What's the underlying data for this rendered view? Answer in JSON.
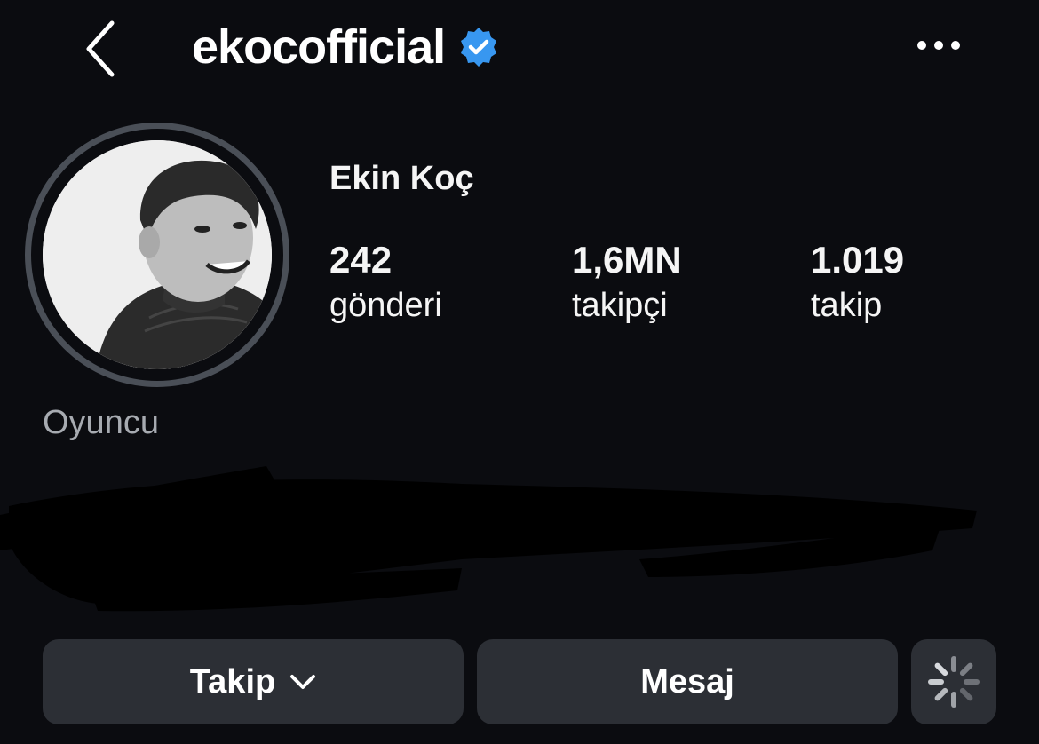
{
  "header": {
    "username": "ekocofficial",
    "verified_icon": "verified-badge-icon",
    "accent_color": "#3897f0"
  },
  "profile": {
    "full_name": "Ekin Koç",
    "category": "Oyuncu",
    "stats": [
      {
        "value": "242",
        "label": "gönderi"
      },
      {
        "value": "1,6MN",
        "label": "takipçi"
      },
      {
        "value": "1.019",
        "label": "takip"
      }
    ]
  },
  "actions": {
    "follow_label": "Takip",
    "message_label": "Mesaj",
    "more_icon": "loading-spinner-icon"
  },
  "icons": {
    "back": "chevron-left-icon",
    "menu": "more-horizontal-icon",
    "dropdown": "chevron-down-icon"
  }
}
